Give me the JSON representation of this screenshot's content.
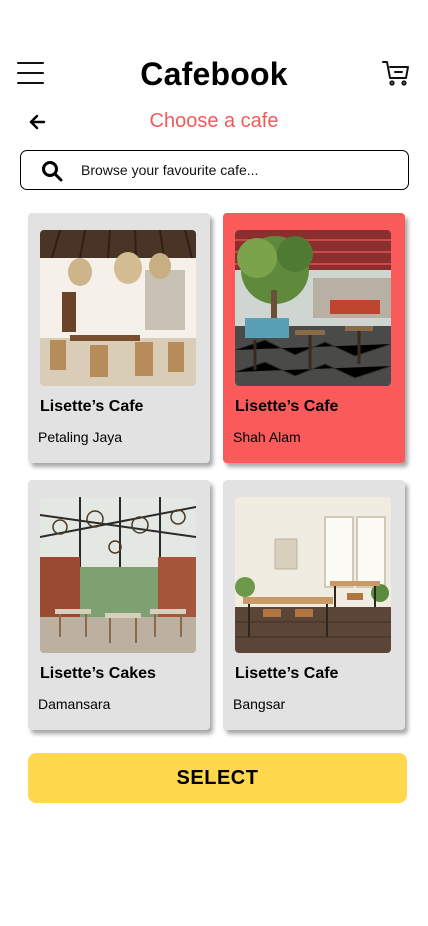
{
  "header": {
    "title": "Cafebook",
    "subtitle": "Choose a cafe"
  },
  "search": {
    "placeholder": "Browse your favourite cafe..."
  },
  "cafes": [
    {
      "name": "Lisette’s Cafe",
      "location": "Petaling Jaya",
      "selected": false
    },
    {
      "name": "Lisette’s Cafe",
      "location": "Shah Alam",
      "selected": true
    },
    {
      "name": "Lisette’s Cakes",
      "location": "Damansara",
      "selected": false
    },
    {
      "name": "Lisette’s Cafe",
      "location": "Bangsar",
      "selected": false
    }
  ],
  "actions": {
    "select_label": "SELECT"
  },
  "icons": {
    "menu": "hamburger-menu-icon",
    "cart": "cart-icon",
    "back": "arrow-left-icon",
    "search": "search-icon"
  },
  "colors": {
    "accent": "#f05a5a",
    "selected_card": "#fa5a5a",
    "card": "#e2e2e2",
    "button": "#ffd84d"
  }
}
